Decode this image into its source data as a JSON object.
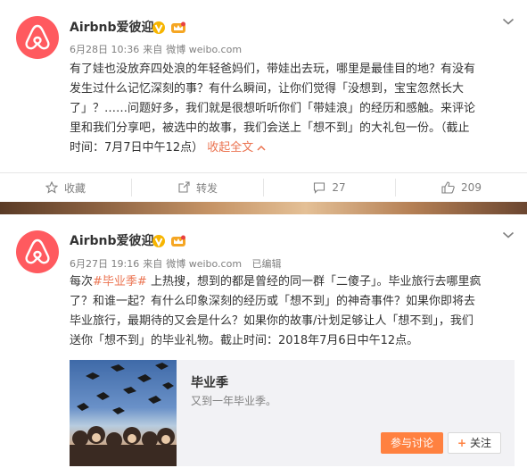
{
  "posts": [
    {
      "username": "Airbnb爱彼迎",
      "date": "6月28日 10:36",
      "source_prefix": "来自",
      "source": "微博 weibo.com",
      "edited": "",
      "text_lines": [
        "有了娃也没放弃四处浪的年轻爸妈们，带娃出去玩，哪里是最佳目的地？有没有",
        "发生过什么记忆深刻的事？有什么瞬间，让你们觉得「没想到，宝宝忽然长大",
        "了」？……问题好多，我们就是很想听听你们「带娃浪」的经历和感触。来评论",
        "里和我们分享吧，被选中的故事，我们会送上「想不到」的大礼包一份。（截止",
        "时间：7月7日中午12点）"
      ],
      "collapse_label": "收起全文",
      "actions": {
        "favorite": "收藏",
        "repost": "转发",
        "comment": "27",
        "like": "209"
      }
    },
    {
      "username": "Airbnb爱彼迎",
      "date": "6月27日 19:16",
      "source_prefix": "来自",
      "source": "微博 weibo.com",
      "edited": "已编辑",
      "text_line1_prefix": "每次",
      "hashtag": "#毕业季#",
      "text_line1_suffix": " 上热搜，想到的都是曾经的同一群「二傻子」。毕业旅行去哪里疯",
      "text_lines": [
        "了？和谁一起？有什么印象深刻的经历或「想不到」的神奇事件？如果你即将去",
        "毕业旅行，最期待的又会是什么？如果你的故事/计划足够让人「想不到」，我们",
        "送你「想不到」的毕业礼物。截止时间：2018年7月6日中午12点。"
      ],
      "card": {
        "title": "毕业季",
        "subtitle": "又到一年毕业季。",
        "discuss_label": "参与讨论",
        "follow_label": "关注"
      }
    }
  ],
  "colors": {
    "brand": "#ff5a5f",
    "highlight": "#eb7350",
    "button": "#ff8140",
    "verified": "#f7b500"
  }
}
